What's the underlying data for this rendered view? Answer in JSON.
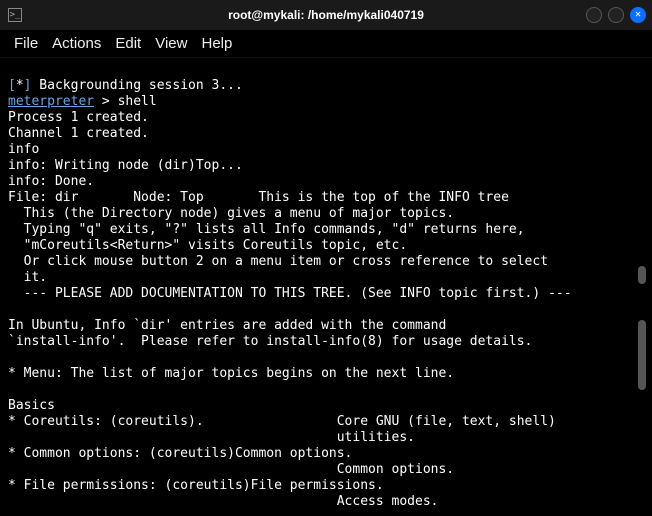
{
  "window": {
    "title": "root@mykali: /home/mykali040719"
  },
  "menu": {
    "file": "File",
    "actions": "Actions",
    "edit": "Edit",
    "view": "View",
    "help": "Help"
  },
  "term": {
    "l1_a": "[",
    "l1_b": "*",
    "l1_c": "]",
    "l1_d": " Backgrounding session 3",
    "l1_e": "...",
    "l2_a": "meterpreter",
    "l2_b": " > shell",
    "l3": "Process 1 created.",
    "l4": "Channel 1 created.",
    "l5": "info",
    "l6_a": "info: Writing node (dir)Top",
    "l6_b": "...",
    "l7": "info: Done.",
    "l8": "File: dir       Node: Top       This is the top of the INFO tree",
    "l9": "  This (the Directory node) gives a menu of major topics.",
    "l10": "  Typing \"q\" exits, \"?\" lists all Info commands, \"d\" returns here,",
    "l11": "  \"mCoreutils<Return>\" visits Coreutils topic, etc.",
    "l12": "  Or click mouse button 2 on a menu item or cross reference to select",
    "l13": "  it.",
    "l14": "  --- PLEASE ADD DOCUMENTATION TO THIS TREE. (See INFO topic first.) ---",
    "l15": "",
    "l16": "In Ubuntu, Info `dir' entries are added with the command",
    "l17": "`install-info'.  Please refer to install-info(8) for usage details.",
    "l18": "",
    "l19": "* Menu: The list of major topics begins on the next line.",
    "l20": "",
    "l21": "Basics",
    "l22": "* Coreutils: (coreutils).                 Core GNU (file, text, shell)",
    "l23": "                                          utilities.",
    "l24": "* Common options: (coreutils)Common options.",
    "l25": "                                          Common options.",
    "l26": "* File permissions: (coreutils)File permissions.",
    "l27": "                                          Access modes."
  }
}
